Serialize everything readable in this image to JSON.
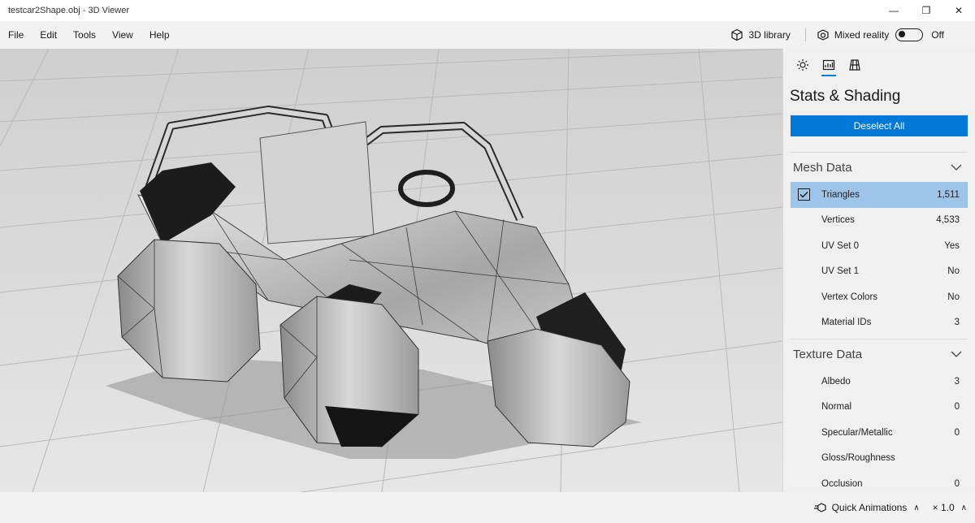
{
  "window": {
    "title": "testcar2Shape.obj - 3D Viewer",
    "minimize": "—",
    "maximize": "❐",
    "close": "✕"
  },
  "menu": {
    "items": [
      "File",
      "Edit",
      "Tools",
      "View",
      "Help"
    ]
  },
  "toolbar": {
    "library_label": "3D library",
    "mixed_reality_label": "Mixed reality",
    "mixed_reality_state": "Off"
  },
  "panel": {
    "tabs": [
      "lighting-tab",
      "stats-tab",
      "grid-tab"
    ],
    "heading": "Stats & Shading",
    "deselect_label": "Deselect All",
    "mesh": {
      "title": "Mesh Data",
      "rows": [
        {
          "label": "Triangles",
          "value": "1,511",
          "selected": true
        },
        {
          "label": "Vertices",
          "value": "4,533"
        },
        {
          "label": "UV Set 0",
          "value": "Yes"
        },
        {
          "label": "UV Set 1",
          "value": "No"
        },
        {
          "label": "Vertex Colors",
          "value": "No"
        },
        {
          "label": "Material IDs",
          "value": "3"
        }
      ]
    },
    "texture": {
      "title": "Texture Data",
      "rows": [
        {
          "label": "Albedo",
          "value": "3"
        },
        {
          "label": "Normal",
          "value": "0"
        },
        {
          "label": "Specular/Metallic",
          "value": "0"
        },
        {
          "label": "Gloss/Roughness",
          "value": ""
        },
        {
          "label": "Occlusion",
          "value": "0"
        }
      ]
    }
  },
  "status": {
    "animations_label": "Quick Animations",
    "speed": "× 1.0"
  },
  "accent": "#0078d7"
}
